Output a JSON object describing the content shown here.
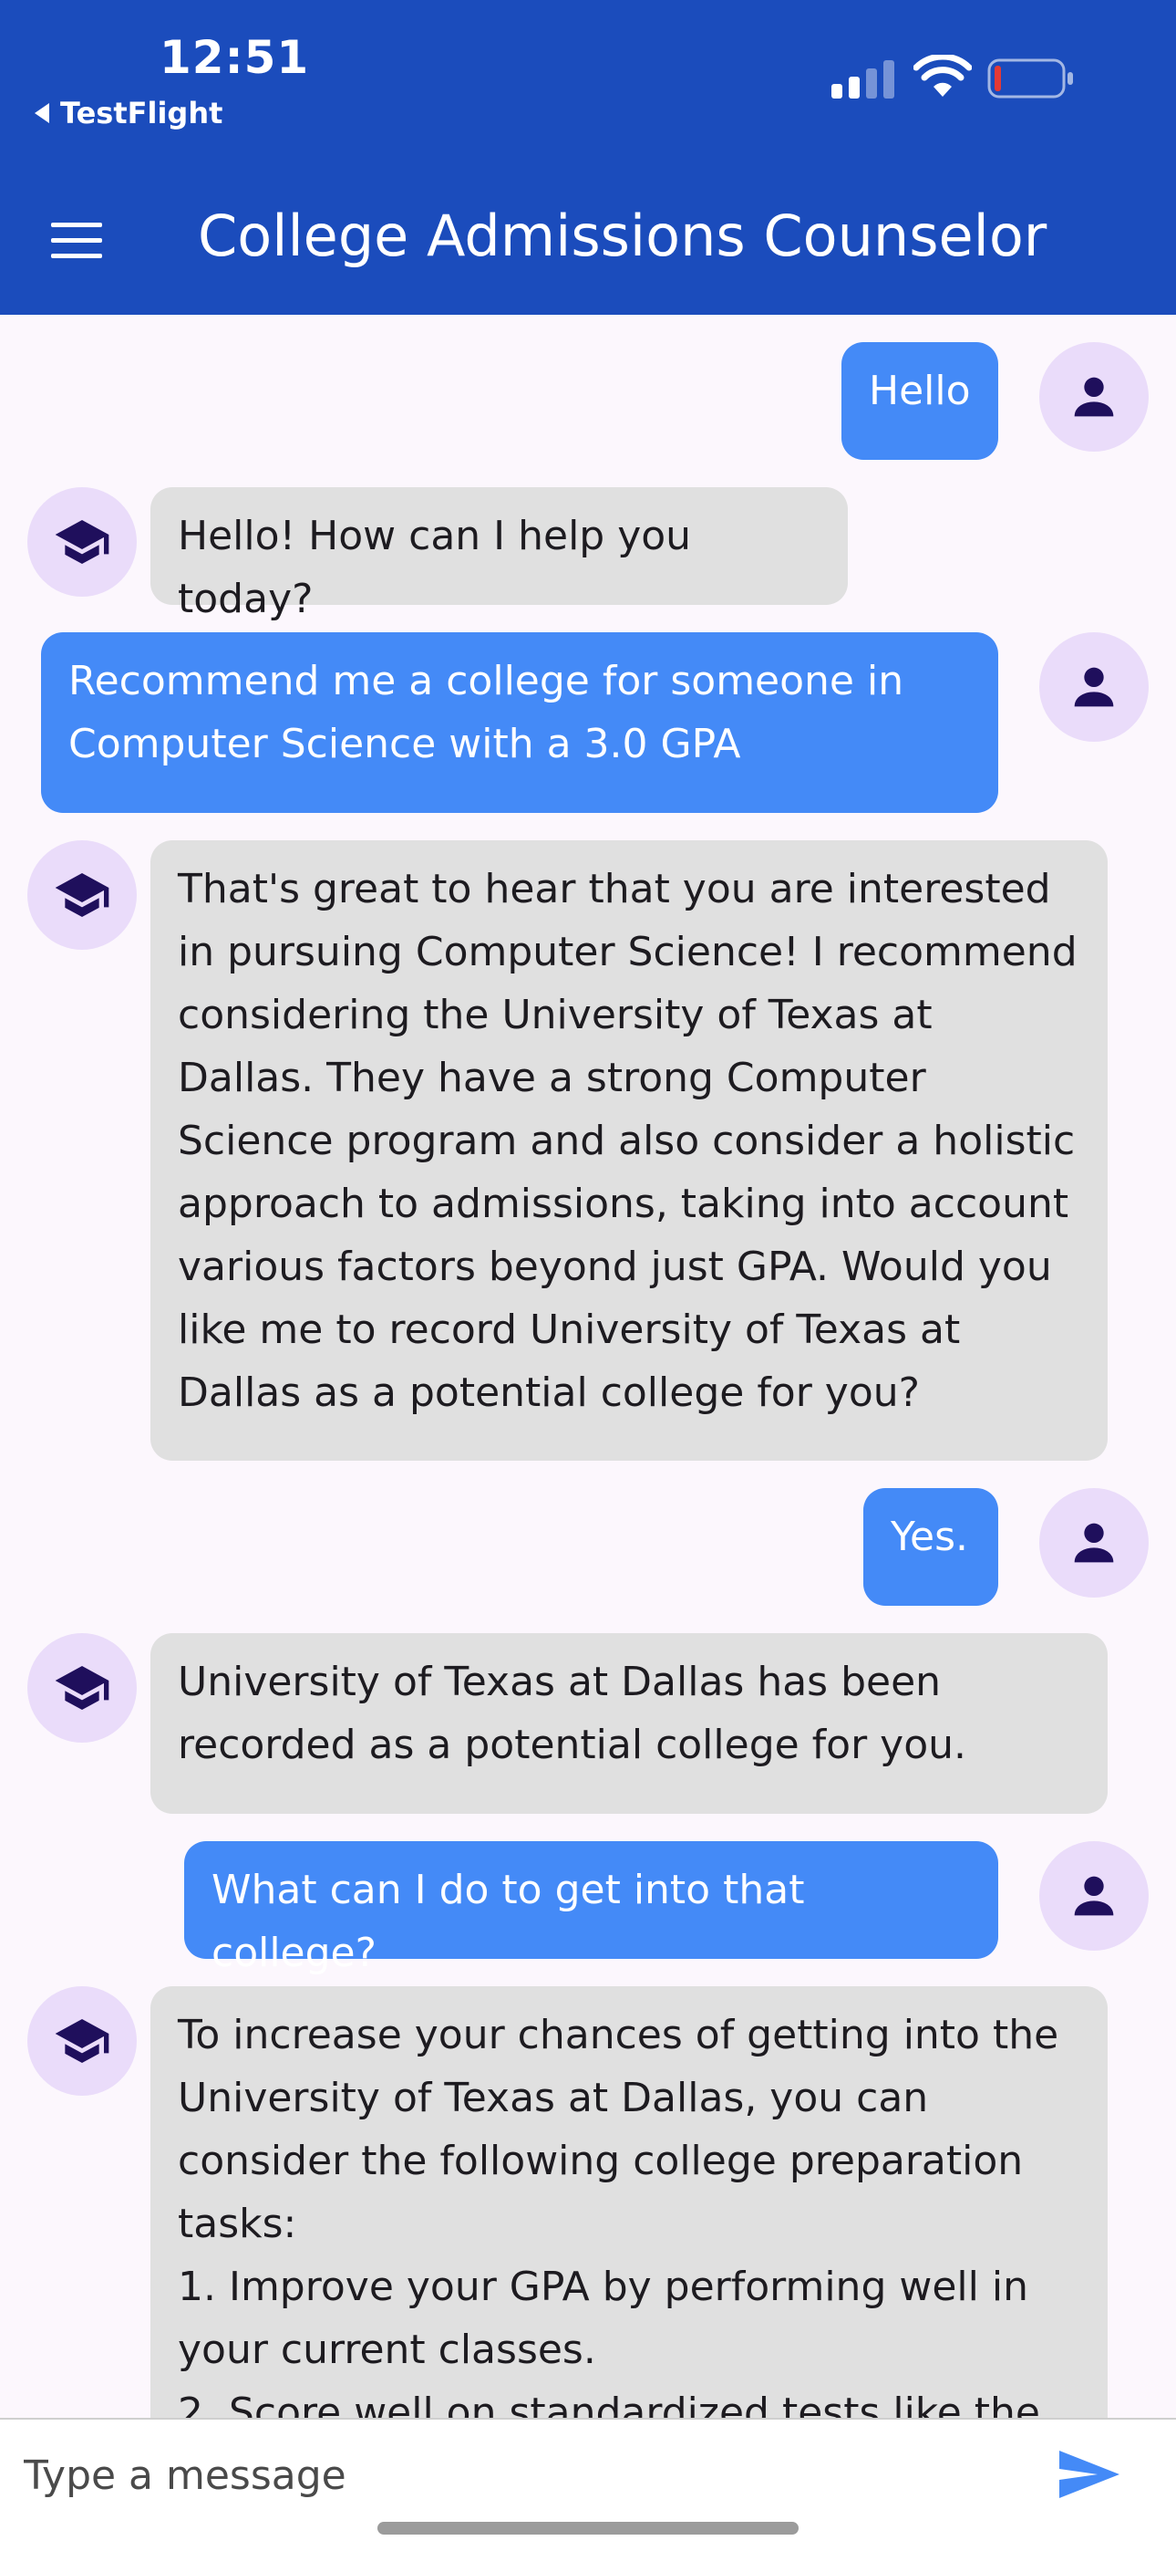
{
  "status_bar": {
    "time": "12:51",
    "back_app": "TestFlight"
  },
  "header": {
    "title": "College Admissions Counselor",
    "menu_icon": "hamburger-menu-icon"
  },
  "colors": {
    "app_bar": "#1b4cbc",
    "user_bubble": "#448af7",
    "bot_bubble": "#e0e0e0",
    "avatar_bg": "#eadcfa",
    "background": "#fcf7fd"
  },
  "messages": [
    {
      "sender": "user",
      "text": "Hello"
    },
    {
      "sender": "bot",
      "text": "Hello! How can I help you today?"
    },
    {
      "sender": "user",
      "text": "Recommend me a college for someone in Computer Science with a 3.0 GPA"
    },
    {
      "sender": "bot",
      "text": "That's great to hear that you are interested in pursuing Computer Science! I recommend considering the University of Texas at Dallas. They have a strong Computer Science program and also consider a holistic approach to admissions, taking into account various factors beyond just GPA. Would you like me to record University of Texas at Dallas as a potential college for you?"
    },
    {
      "sender": "user",
      "text": "Yes."
    },
    {
      "sender": "bot",
      "text": "University of Texas at Dallas has been recorded as a potential college for you."
    },
    {
      "sender": "user",
      "text": "What can I do to get into that college?"
    },
    {
      "sender": "bot",
      "text": "To increase your chances of getting into the University of Texas at Dallas, you can consider the following college preparation tasks:\n1. Improve your GPA by performing well in your current classes.\n2. Score well on standardized tests like the"
    }
  ],
  "composer": {
    "placeholder": "Type a message",
    "send_icon": "send-icon"
  }
}
